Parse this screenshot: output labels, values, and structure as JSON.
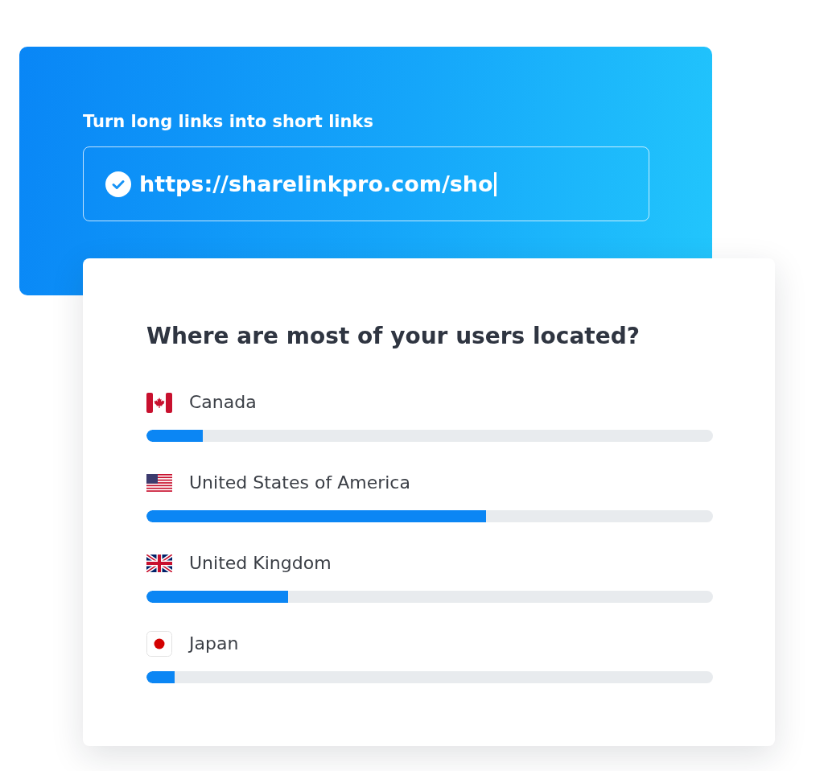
{
  "hero": {
    "heading": "Turn long links into short links",
    "url_field": {
      "value": "https://sharelinkpro.com/sho",
      "verified": true,
      "focused": true
    }
  },
  "card": {
    "title": "Where are most of your users located?",
    "countries": [
      {
        "name": "Canada",
        "kind": "canada",
        "level": 0.1
      },
      {
        "name": "United States of America",
        "kind": "usa",
        "level": 0.6
      },
      {
        "name": "United Kingdom",
        "kind": "uk",
        "level": 0.25
      },
      {
        "name": "Japan",
        "kind": "japan",
        "level": 0.05
      }
    ]
  }
}
